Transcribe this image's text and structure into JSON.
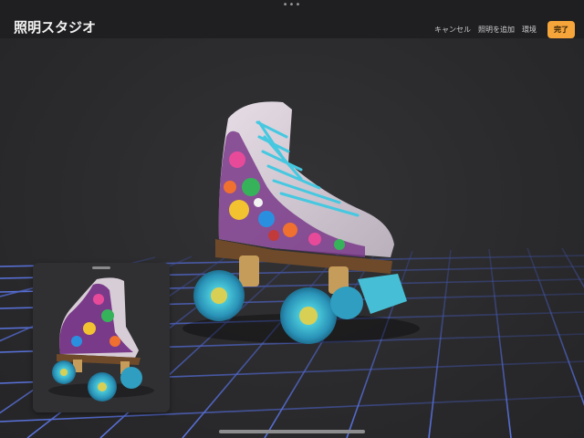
{
  "window": {
    "grabber": "•••"
  },
  "header": {
    "title": "照明スタジオ",
    "actions": {
      "cancel": "キャンセル",
      "add_light": "照明を追加",
      "environment": "環境",
      "done": "完了"
    }
  },
  "colors": {
    "accent": "#f5a53a",
    "grid": "#4a62c8",
    "background": "#2b2b2d"
  }
}
